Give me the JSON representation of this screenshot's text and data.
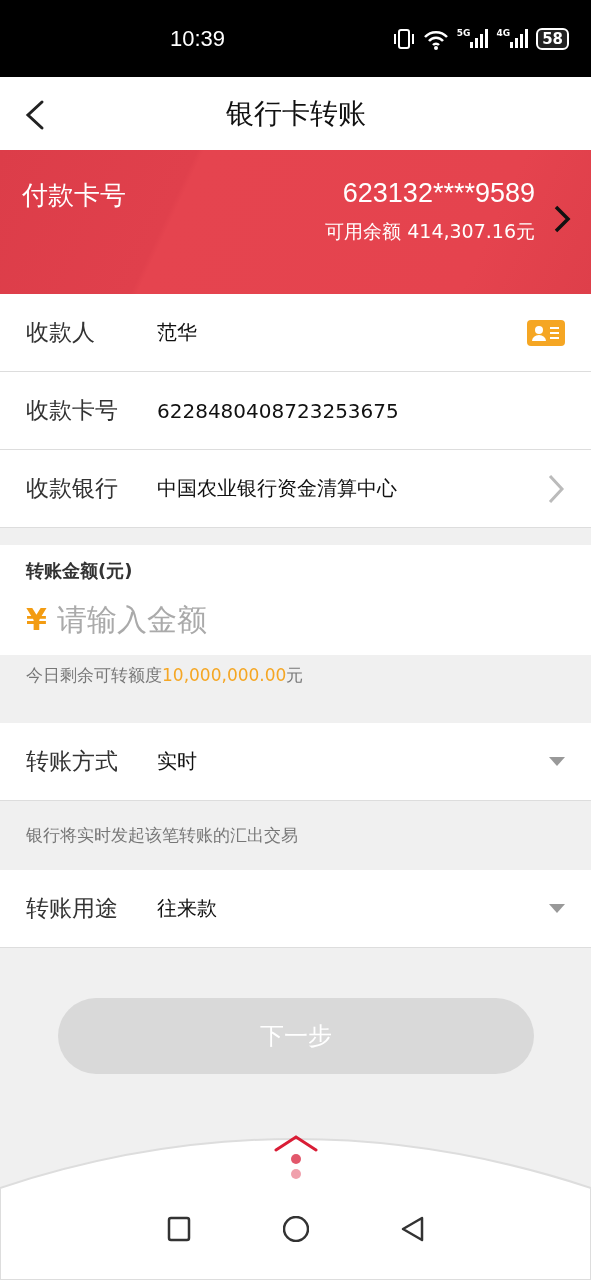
{
  "status_bar": {
    "time": "10:39",
    "networks": [
      "5G",
      "4G"
    ],
    "battery": "58"
  },
  "header": {
    "title": "银行卡转账"
  },
  "payer_card": {
    "label": "付款卡号",
    "card_number": "623132****9589",
    "balance": "可用余额 414,307.16元"
  },
  "payee_rows": [
    {
      "label": "收款人",
      "value": "范华",
      "kind": "contacts"
    },
    {
      "label": "收款卡号",
      "value": "6228480408723253675",
      "kind": "plain"
    },
    {
      "label": "收款银行",
      "value": "中国农业银行资金清算中心",
      "kind": "link"
    }
  ],
  "amount": {
    "label": "转账金额(元)",
    "currency": "¥",
    "placeholder": "请输入金额"
  },
  "quota": {
    "prefix": "今日剩余可转额度",
    "amount": "10,000,000.00",
    "suffix": "元"
  },
  "method": {
    "label": "转账方式",
    "value": "实时",
    "note": "银行将实时发起该笔转账的汇出交易"
  },
  "purpose": {
    "label": "转账用途",
    "value": "往来款"
  },
  "next_button": {
    "label": "下一步",
    "disabled": true
  }
}
